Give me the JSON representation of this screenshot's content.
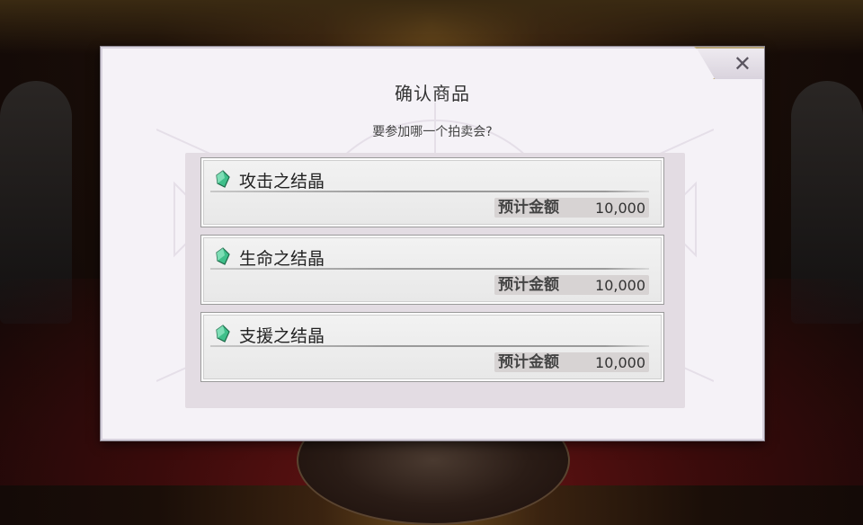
{
  "dialog": {
    "title": "确认商品",
    "subtitle": "要参加哪一个拍卖会?",
    "close_icon": "close-x-icon"
  },
  "items": [
    {
      "name": "攻击之结晶",
      "price_label": "预计金额",
      "price_value": "10,000",
      "icon": "green-crystal-icon"
    },
    {
      "name": "生命之结晶",
      "price_label": "预计金额",
      "price_value": "10,000",
      "icon": "green-crystal-icon"
    },
    {
      "name": "支援之结晶",
      "price_label": "预计金额",
      "price_value": "10,000",
      "icon": "green-crystal-icon"
    }
  ],
  "colors": {
    "dialog_bg": "#f5f2f7",
    "panel_bg": "#e3dce3",
    "crystal": "#3fbf8a",
    "gold_trim": "#c4b07c"
  }
}
